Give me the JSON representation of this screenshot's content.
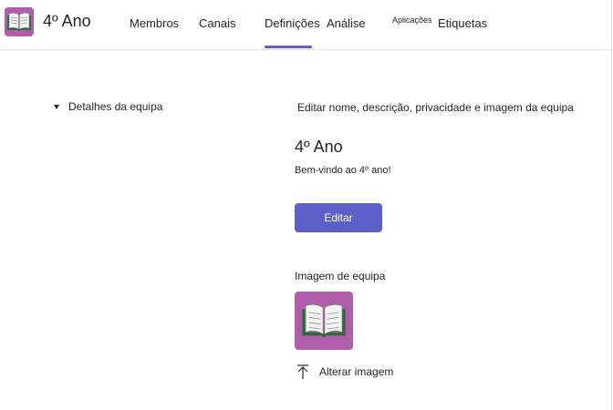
{
  "header": {
    "team_name": "4º Ano",
    "team_avatar_icon": "open-book-icon",
    "avatar_color": "#b05eab",
    "tabs": [
      {
        "label": "Membros"
      },
      {
        "label": "Canais"
      },
      {
        "label": "Definições",
        "active": true
      },
      {
        "label": "Análise"
      },
      {
        "label": "Aplicações"
      },
      {
        "label": "Etiquetas"
      }
    ]
  },
  "main": {
    "section_title": "Detalhes da equipa",
    "section_description": "Editar nome, descrição, privacidade e imagem da equipa",
    "team_name": "4º Ano",
    "team_description": "Bem-vindo ao 4º ano!",
    "edit_label": "Editar",
    "image_label": "Imagem de equipa",
    "change_image_label": "Alterar imagem",
    "change_image_icon": "upload-icon"
  },
  "colors": {
    "accent": "#5b5fc7",
    "team_color": "#b05eab"
  }
}
